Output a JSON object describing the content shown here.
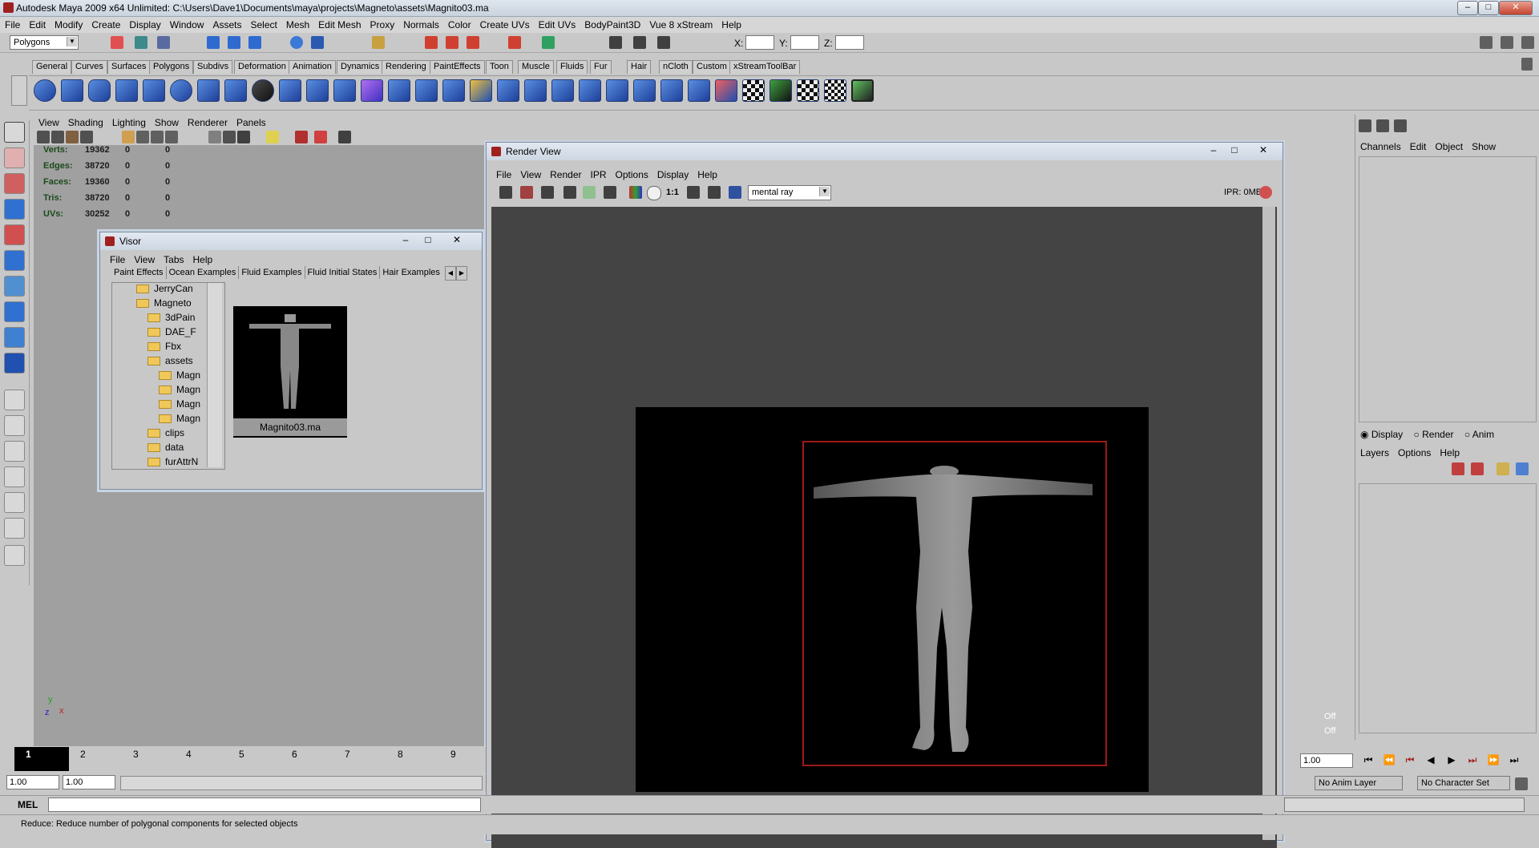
{
  "window": {
    "title": "Autodesk Maya 2009 x64 Unlimited: C:\\Users\\Dave1\\Documents\\maya\\projects\\Magneto\\assets\\Magnito03.ma"
  },
  "menubar": [
    "File",
    "Edit",
    "Modify",
    "Create",
    "Display",
    "Window",
    "Assets",
    "Select",
    "Mesh",
    "Edit Mesh",
    "Proxy",
    "Normals",
    "Color",
    "Create UVs",
    "Edit UVs",
    "BodyPaint3D",
    "Vue 8 xStream",
    "Help"
  ],
  "status": {
    "mode": "Polygons",
    "x_label": "X:",
    "y_label": "Y:",
    "z_label": "Z:"
  },
  "shelf_tabs": [
    "General",
    "Curves",
    "Surfaces",
    "Polygons",
    "Subdivs",
    "Deformation",
    "Animation",
    "Dynamics",
    "Rendering",
    "PaintEffects",
    "Toon",
    "Muscle",
    "Fluids",
    "Fur",
    "Hair",
    "nCloth",
    "Custom",
    "xStreamToolBar"
  ],
  "viewport": {
    "menu": [
      "View",
      "Shading",
      "Lighting",
      "Show",
      "Renderer",
      "Panels"
    ],
    "hud": [
      {
        "label": "Verts:",
        "v1": "19362",
        "v2": "0",
        "v3": "0"
      },
      {
        "label": "Edges:",
        "v1": "38720",
        "v2": "0",
        "v3": "0"
      },
      {
        "label": "Faces:",
        "v1": "19360",
        "v2": "0",
        "v3": "0"
      },
      {
        "label": "Tris:",
        "v1": "38720",
        "v2": "0",
        "v3": "0"
      },
      {
        "label": "UVs:",
        "v1": "30252",
        "v2": "0",
        "v3": "0"
      }
    ],
    "axis_y": "y",
    "axis_z": "z",
    "axis_x": "x"
  },
  "visor": {
    "title": "Visor",
    "menu": [
      "File",
      "View",
      "Tabs",
      "Help"
    ],
    "tabs": [
      "Paint Effects",
      "Ocean Examples",
      "Fluid Examples",
      "Fluid Initial States",
      "Hair Examples"
    ],
    "tree": [
      "JerryCan",
      "Magneto",
      "3dPain",
      "DAE_F",
      "Fbx",
      "assets",
      "Magn",
      "Magn",
      "Magn",
      "Magn",
      "clips",
      "data",
      "furAttrN"
    ],
    "thumb_label": "Magnito03.ma"
  },
  "renderview": {
    "title": "Render View",
    "menu": [
      "File",
      "View",
      "Render",
      "IPR",
      "Options",
      "Display",
      "Help"
    ],
    "ratio": "1:1",
    "renderer": "mental ray",
    "ipr": "IPR: 0MB"
  },
  "rightpanel": {
    "channel_menu": [
      "Channels",
      "Edit",
      "Object",
      "Show"
    ],
    "layer_modes": [
      "Display",
      "Render",
      "Anim"
    ],
    "layer_menu": [
      "Layers",
      "Options",
      "Help"
    ],
    "off1": "Off",
    "off2": "Off"
  },
  "timeline": {
    "current": "1",
    "ticks": [
      "1",
      "2",
      "3",
      "4",
      "5",
      "6",
      "7",
      "8",
      "9"
    ],
    "start": "1.00",
    "start2": "1.00",
    "current_field": "1.00",
    "anim_layer": "No Anim Layer",
    "char_set": "No Character Set"
  },
  "cmd": {
    "label": "MEL"
  },
  "help": {
    "text": "Reduce: Reduce number of polygonal components for selected objects"
  },
  "colors": {
    "accent": "#1d3f9a",
    "render_bg": "#000000",
    "region": "#a01818"
  }
}
